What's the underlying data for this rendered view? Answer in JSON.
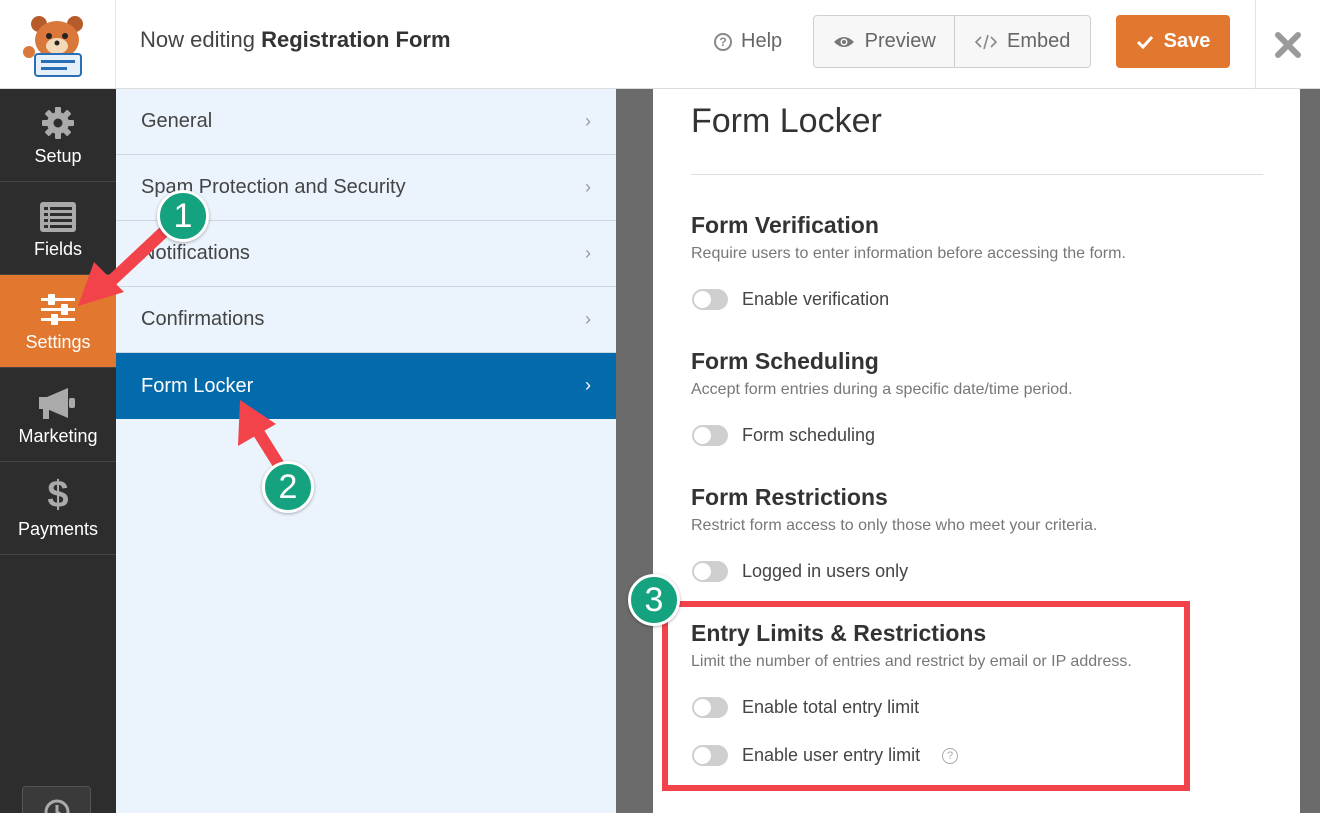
{
  "header": {
    "title_prefix": "Now editing",
    "form_name": "Registration Form",
    "help_label": "Help",
    "preview_label": "Preview",
    "embed_label": "Embed",
    "save_label": "Save",
    "logo_icon": "wpforms-bear-logo",
    "close_icon": "close-icon"
  },
  "sidebar": {
    "items": [
      {
        "label": "Setup",
        "icon": "gear-icon"
      },
      {
        "label": "Fields",
        "icon": "list-icon"
      },
      {
        "label": "Settings",
        "icon": "sliders-icon",
        "active": true
      },
      {
        "label": "Marketing",
        "icon": "megaphone-icon"
      },
      {
        "label": "Payments",
        "icon": "dollar-icon"
      }
    ],
    "active_color": "#e27730"
  },
  "settings_menu": {
    "items": [
      {
        "label": "General"
      },
      {
        "label": "Spam Protection and Security"
      },
      {
        "label": "Notifications"
      },
      {
        "label": "Confirmations"
      },
      {
        "label": "Form Locker",
        "active": true
      }
    ],
    "active_color": "#036aab"
  },
  "content": {
    "title": "Form Locker",
    "sections": [
      {
        "title": "Form Verification",
        "description": "Require users to enter information before accessing the form.",
        "toggles": [
          {
            "label": "Enable verification",
            "on": false
          }
        ]
      },
      {
        "title": "Form Scheduling",
        "description": "Accept form entries during a specific date/time period.",
        "toggles": [
          {
            "label": "Form scheduling",
            "on": false
          }
        ]
      },
      {
        "title": "Form Restrictions",
        "description": "Restrict form access to only those who meet your criteria.",
        "toggles": [
          {
            "label": "Logged in users only",
            "on": false
          }
        ]
      },
      {
        "title": "Entry Limits & Restrictions",
        "description": "Limit the number of entries and restrict by email or IP address.",
        "toggles": [
          {
            "label": "Enable total entry limit",
            "on": false
          },
          {
            "label": "Enable user entry limit",
            "on": false,
            "help_icon": "question-icon"
          }
        ]
      }
    ]
  },
  "annotations": {
    "badges": [
      "1",
      "2",
      "3"
    ],
    "highlight_color": "#f2434b",
    "badge_color": "#15a37f"
  }
}
